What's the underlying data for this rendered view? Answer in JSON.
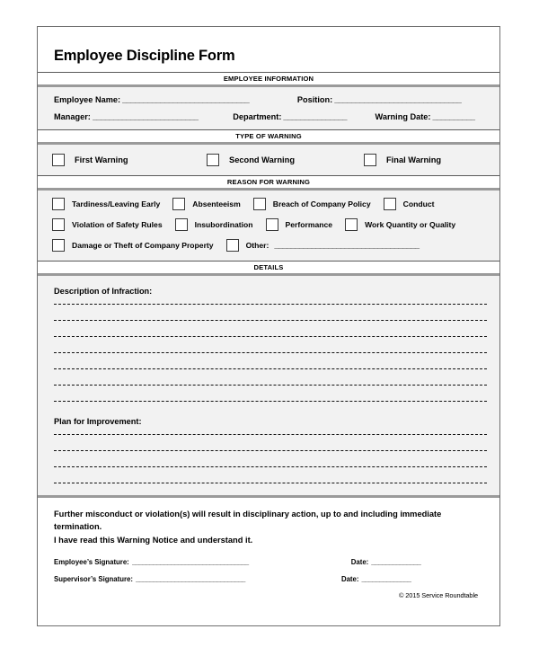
{
  "document": {
    "title": "Employee Discipline Form",
    "copyright": "© 2015 Service Roundtable"
  },
  "sections": {
    "employee_information": {
      "heading": "EMPLOYEE INFORMATION",
      "fields": {
        "employee_name_label": "Employee Name:",
        "employee_name_value": "______________________________",
        "position_label": "Position:",
        "position_value": "______________________________",
        "manager_label": "Manager:",
        "manager_value": "_________________________",
        "department_label": "Department:",
        "department_value": "_______________",
        "warning_date_label": "Warning Date:",
        "warning_date_value": "__________"
      }
    },
    "type_of_warning": {
      "heading": "TYPE OF WARNING",
      "options": [
        {
          "label": "First Warning",
          "checked": false
        },
        {
          "label": "Second Warning",
          "checked": false
        },
        {
          "label": "Final Warning",
          "checked": false
        }
      ]
    },
    "reason_for_warning": {
      "heading": "REASON FOR WARNING",
      "row1": [
        {
          "label": "Tardiness/Leaving Early",
          "checked": false
        },
        {
          "label": "Absenteeism",
          "checked": false
        },
        {
          "label": "Breach of Company Policy",
          "checked": false
        },
        {
          "label": "Conduct",
          "checked": false
        }
      ],
      "row2": [
        {
          "label": "Violation of Safety Rules",
          "checked": false
        },
        {
          "label": "Insubordination",
          "checked": false
        },
        {
          "label": "Performance",
          "checked": false
        },
        {
          "label": "Work Quantity or Quality",
          "checked": false
        }
      ],
      "row3": [
        {
          "label": "Damage or Theft of Company Property",
          "checked": false
        }
      ],
      "other_label": "Other:",
      "other_value": "___________________________________"
    },
    "details": {
      "heading": "DETAILS",
      "description_label": "Description of Infraction:",
      "description_line_count": 7,
      "plan_label": "Plan for Improvement:",
      "plan_line_count": 4
    },
    "acknowledgment": {
      "statement_line1": "Further misconduct or violation(s) will result in disciplinary action, up to and including immediate termination.",
      "statement_line2": "I have read this Warning Notice and understand it.",
      "employee_signature_label": "Employee’s Signature:",
      "employee_signature_value": "_________________________________",
      "employee_date_label": "Date:",
      "employee_date_value": "______________",
      "supervisor_signature_label": "Supervisor’s Signature:",
      "supervisor_signature_value": "_______________________________",
      "supervisor_date_label": "Date:",
      "supervisor_date_value": "______________"
    }
  },
  "colors": {
    "shaded_row": "#f2f2f2",
    "border": "#6f6f6f",
    "band_rule": "#9a9a9a"
  }
}
